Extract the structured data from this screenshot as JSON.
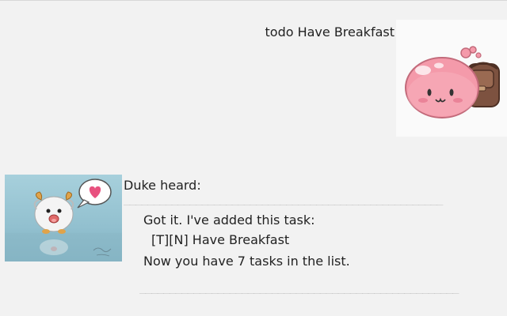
{
  "user_message": {
    "text": "todo Have Breakfast",
    "avatar_icon": "pink-poring-with-backpack-icon"
  },
  "duke_message": {
    "avatar_icon": "poro-with-heart-bubble-icon",
    "heard_label": "Duke heard:",
    "divider_top": "_____________________________________________________",
    "lines": [
      "Got it. I've added this task:",
      "[T][N] Have Breakfast",
      "Now you have 7 tasks in the list."
    ],
    "divider_bottom": "_____________________________________________________"
  },
  "colors": {
    "background": "#f2f2f2",
    "text": "#222222",
    "poring_pink": "#f4a0ae",
    "backpack_brown": "#8a5a44",
    "heart_pink": "#e8517f",
    "duke_bg": "#9ec9d6"
  }
}
